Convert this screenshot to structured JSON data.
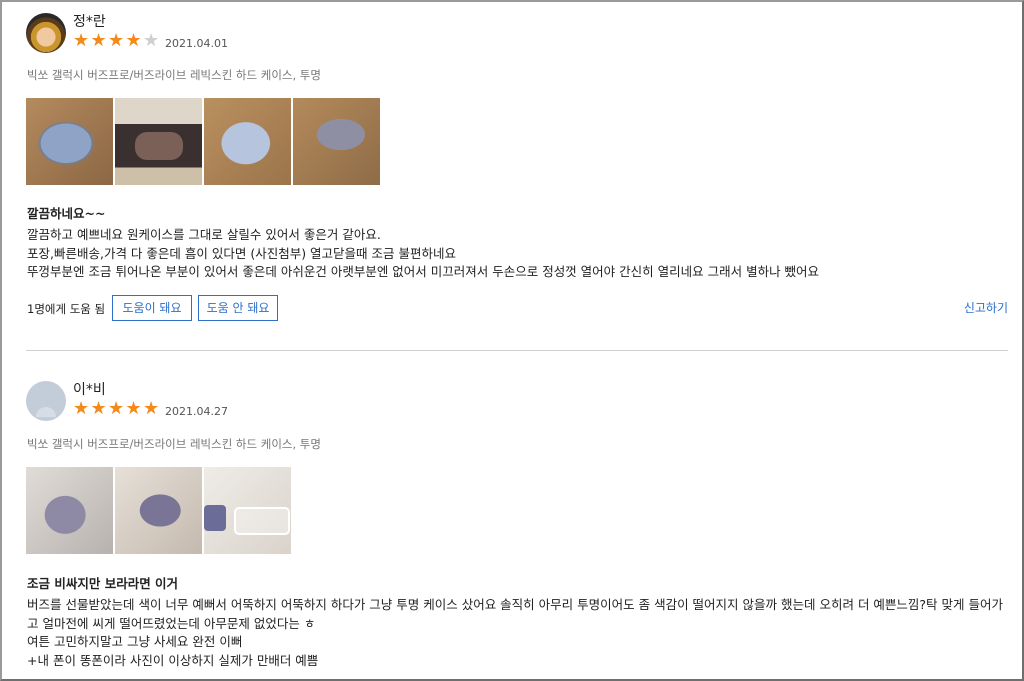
{
  "reviews": [
    {
      "author": "정*란",
      "rating": 4,
      "rating_max": 5,
      "date": "2021.04.01",
      "option": "빅쏘 갤럭시 버즈프로/버즈라이브 레빅스킨 하드 케이스, 투명",
      "title": "깔끔하네요~~",
      "body": "깔끔하고 예쁘네요 원케이스를 그대로 살릴수 있어서 좋은거 같아요.\n포장,빠른배송,가격 다 좋은데 흠이 있다면 (사진첨부) 열고닫을때 조금 불편하네요\n뚜껑부분엔 조금 튀어나온 부분이 있어서 좋은데 아쉬운건 아랫부분엔 없어서 미끄러져서 두손으로 정성껏 열어야 간신히 열리네요 그래서 별하나 뺐어요",
      "helpful_count": "1명에게 도움 됨",
      "helpful_yes": "도움이 돼요",
      "helpful_no": "도움 안 돼요",
      "report": "신고하기"
    },
    {
      "author": "이*비",
      "rating": 5,
      "rating_max": 5,
      "date": "2021.04.27",
      "option": "빅쏘 갤럭시 버즈프로/버즈라이브 레빅스킨 하드 케이스, 투명",
      "title": "조금 비싸지만 보라라면 이거",
      "body": "버즈를 선물받았는데 색이 너무 예뻐서 어뚝하지 어뚝하지 하다가 그냥 투명 케이스 샀어요 솔직히 아무리 투명이어도 좀 색감이 떨어지지 않을까 했는데 오히려 더 예쁜느낌?탁 맞게 들어가고 얼마전에 씨게 떨어뜨렸었는데 아무문제 없었다는 ㅎ\n여튼 고민하지말고 그냥 사세요 완전 이뻐\n+내 폰이 똥폰이라 사진이 이상하지 실제가 만배더 예쁨"
    }
  ],
  "colors": {
    "star_on": "#f28a1c",
    "star_off": "#cfcfcf",
    "link_blue": "#2d6fc9"
  }
}
